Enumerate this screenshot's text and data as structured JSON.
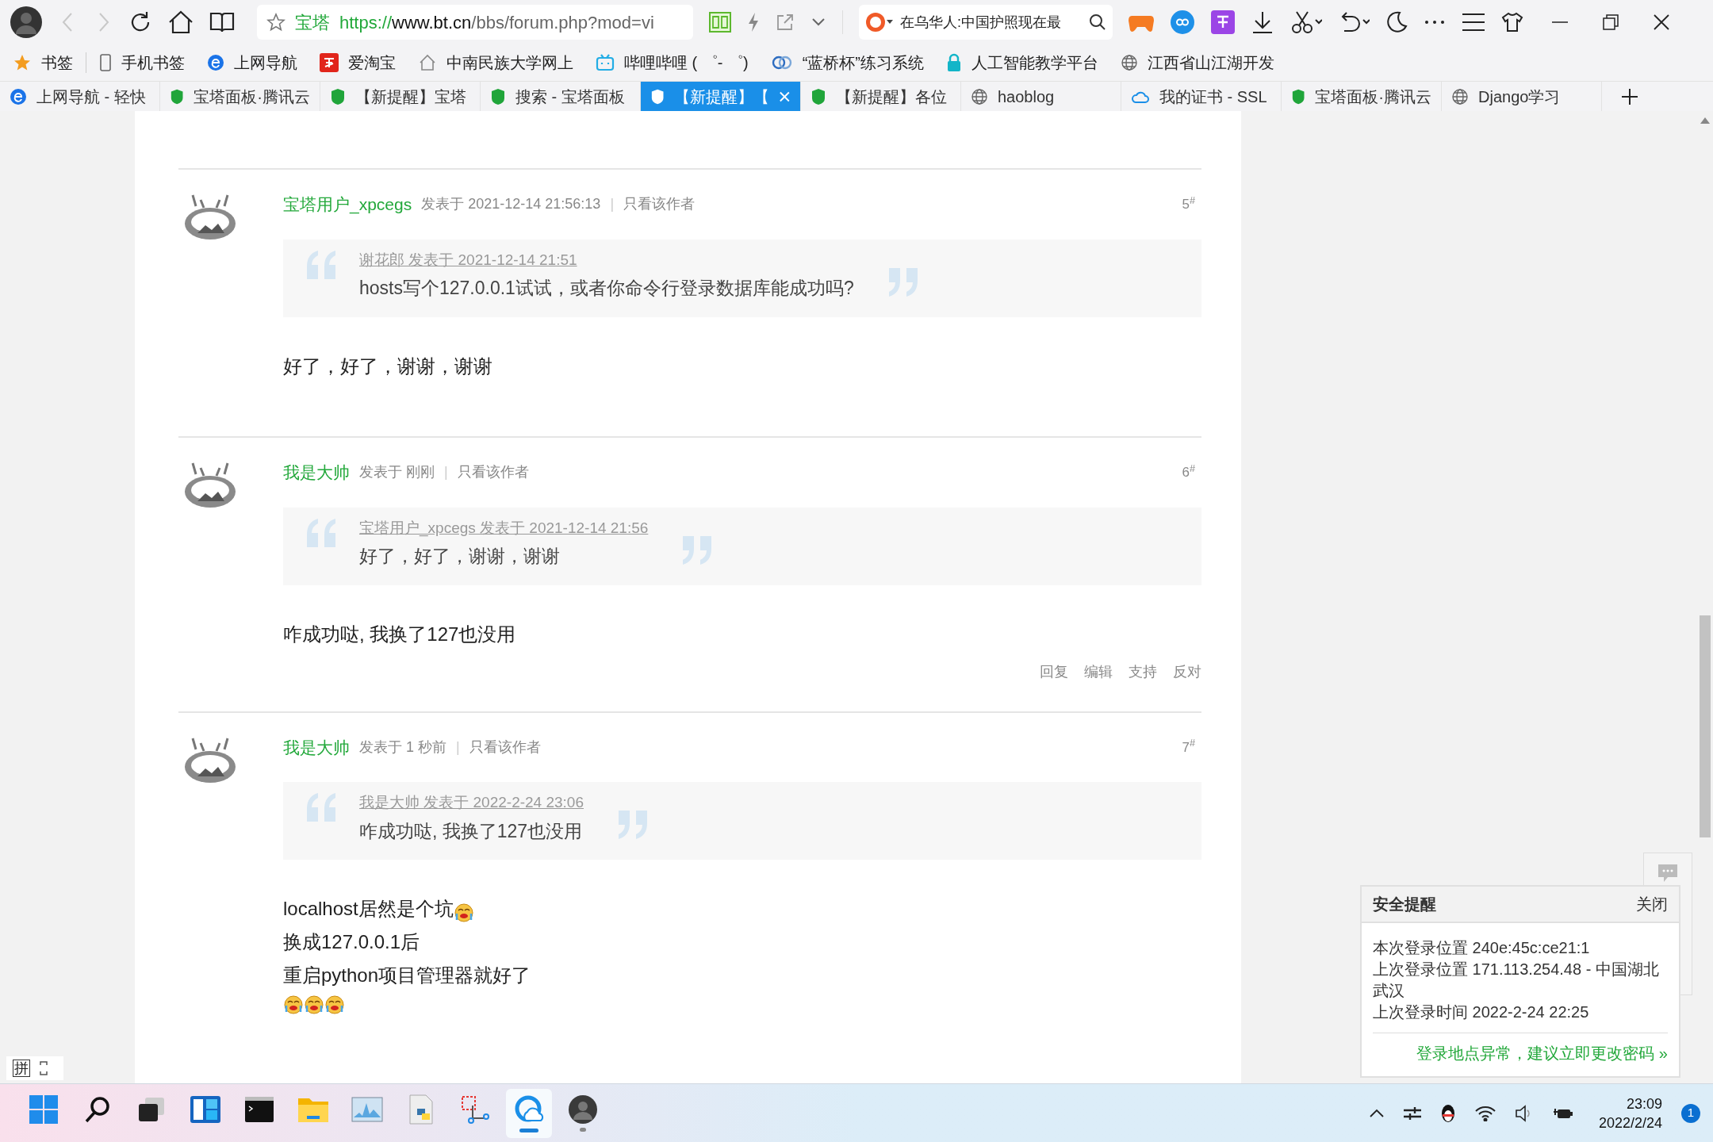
{
  "toolbar": {
    "back_disabled": true,
    "forward_disabled": true,
    "site_label": "宝塔",
    "url": {
      "scheme": "https://",
      "host": "www.bt.cn",
      "path": "/bbs/forum.php?mod=vi"
    },
    "search_value": "在乌华人:中国护照现在最"
  },
  "bookmarks": [
    {
      "kind": "star",
      "label": "书签"
    },
    {
      "kind": "phone",
      "label": "手机书签"
    },
    {
      "kind": "ie",
      "label": "上网导航"
    },
    {
      "kind": "taobao",
      "label": "爱淘宝"
    },
    {
      "kind": "house",
      "label": "中南民族大学网上"
    },
    {
      "kind": "tv",
      "label": "哔哩哔哩 ( ゜- ゜)"
    },
    {
      "kind": "rings",
      "label": "“蓝桥杯”练习系统"
    },
    {
      "kind": "lock",
      "label": "人工智能教学平台"
    },
    {
      "kind": "globe",
      "label": "江西省山江湖开发"
    }
  ],
  "tabs": [
    {
      "kind": "ie",
      "label": "上网导航 - 轻快",
      "selected": false
    },
    {
      "kind": "shield",
      "label": "宝塔面板·腾讯云",
      "selected": false
    },
    {
      "kind": "shield",
      "label": "【新提醒】宝塔",
      "selected": false
    },
    {
      "kind": "shield",
      "label": "搜索 - 宝塔面板",
      "selected": false
    },
    {
      "kind": "shield",
      "label": "【新提醒】【",
      "selected": true
    },
    {
      "kind": "shield",
      "label": "【新提醒】各位",
      "selected": false
    },
    {
      "kind": "globe",
      "label": "haoblog",
      "selected": false
    },
    {
      "kind": "cloud",
      "label": "我的证书 - SSL",
      "selected": false
    },
    {
      "kind": "shield",
      "label": "宝塔面板·腾讯云",
      "selected": false
    },
    {
      "kind": "globe",
      "label": "Django学习",
      "selected": false
    }
  ],
  "posts": [
    {
      "author": "宝塔用户_xpcegs",
      "posted": "发表于 2021-12-14 21:56:13",
      "separator": "|",
      "author_only": "只看该作者",
      "floor": "5$^{#}$",
      "quote": {
        "cite": "谢花郎 发表于 2021-12-14 21:51",
        "text": "hosts写个127.0.0.1试试，或者你命令行登录数据库能成功吗?"
      },
      "body": [
        [
          {
            "kind": "text",
            "text": "好了，好了，谢谢，谢谢"
          }
        ]
      ]
    },
    {
      "author": "我是大帅",
      "posted": "发表于 刚刚",
      "separator": "|",
      "author_only": "只看该作者",
      "floor": "6$^{#}$",
      "quote": {
        "cite": "宝塔用户_xpcegs 发表于 2021-12-14 21:56",
        "text": "好了，好了，谢谢，谢谢"
      },
      "body": [
        [
          {
            "kind": "text",
            "text": "咋成功哒, 我换了127也没用"
          }
        ]
      ],
      "actions": [
        "回复",
        "编辑",
        "支持",
        "反对"
      ]
    },
    {
      "author": "我是大帅",
      "posted": "发表于 1 秒前",
      "separator": "|",
      "author_only": "只看该作者",
      "floor": "7$^{#}$",
      "quote": {
        "cite": "我是大帅 发表于 2022-2-24 23:06",
        "text": "咋成功哒, 我换了127也没用"
      },
      "body": [
        [
          {
            "kind": "text",
            "text": "localhost居然是个坑"
          },
          {
            "kind": "emoji"
          }
        ],
        [
          {
            "kind": "text",
            "text": "换成127.0.0.1后"
          }
        ],
        [
          {
            "kind": "text",
            "text": "重启python项目管理器就好了"
          }
        ],
        [
          {
            "kind": "emoji"
          },
          {
            "kind": "emoji"
          },
          {
            "kind": "emoji"
          }
        ]
      ]
    }
  ],
  "security_popup": {
    "title": "安全提醒",
    "close": "关闭",
    "lines": [
      "本次登录位置 240e:45c:ce21:1",
      "上次登录位置 171.113.254.48 - 中国湖北武汉",
      "上次登录时间 2022-2-24 22:25"
    ],
    "link": "登录地点异常，建议立即更改密码 »"
  },
  "ime": {
    "label": "拼"
  },
  "taskbar": {
    "apps": [
      {
        "kind": "start",
        "selected": false,
        "running": false
      },
      {
        "kind": "search",
        "selected": false,
        "running": false
      },
      {
        "kind": "taskview",
        "selected": false,
        "running": false
      },
      {
        "kind": "widgets",
        "selected": false,
        "running": false
      },
      {
        "kind": "terminal",
        "selected": false,
        "running": false
      },
      {
        "kind": "folder",
        "selected": false,
        "running": false
      },
      {
        "kind": "monitor",
        "selected": false,
        "running": false
      },
      {
        "kind": "python",
        "selected": false,
        "running": false
      },
      {
        "kind": "snip",
        "selected": false,
        "running": false
      },
      {
        "kind": "browser",
        "selected": true,
        "running": true
      },
      {
        "kind": "avatar",
        "selected": false,
        "running": true
      }
    ],
    "time": "23:09",
    "date": "2022/2/24",
    "badge": "1"
  }
}
